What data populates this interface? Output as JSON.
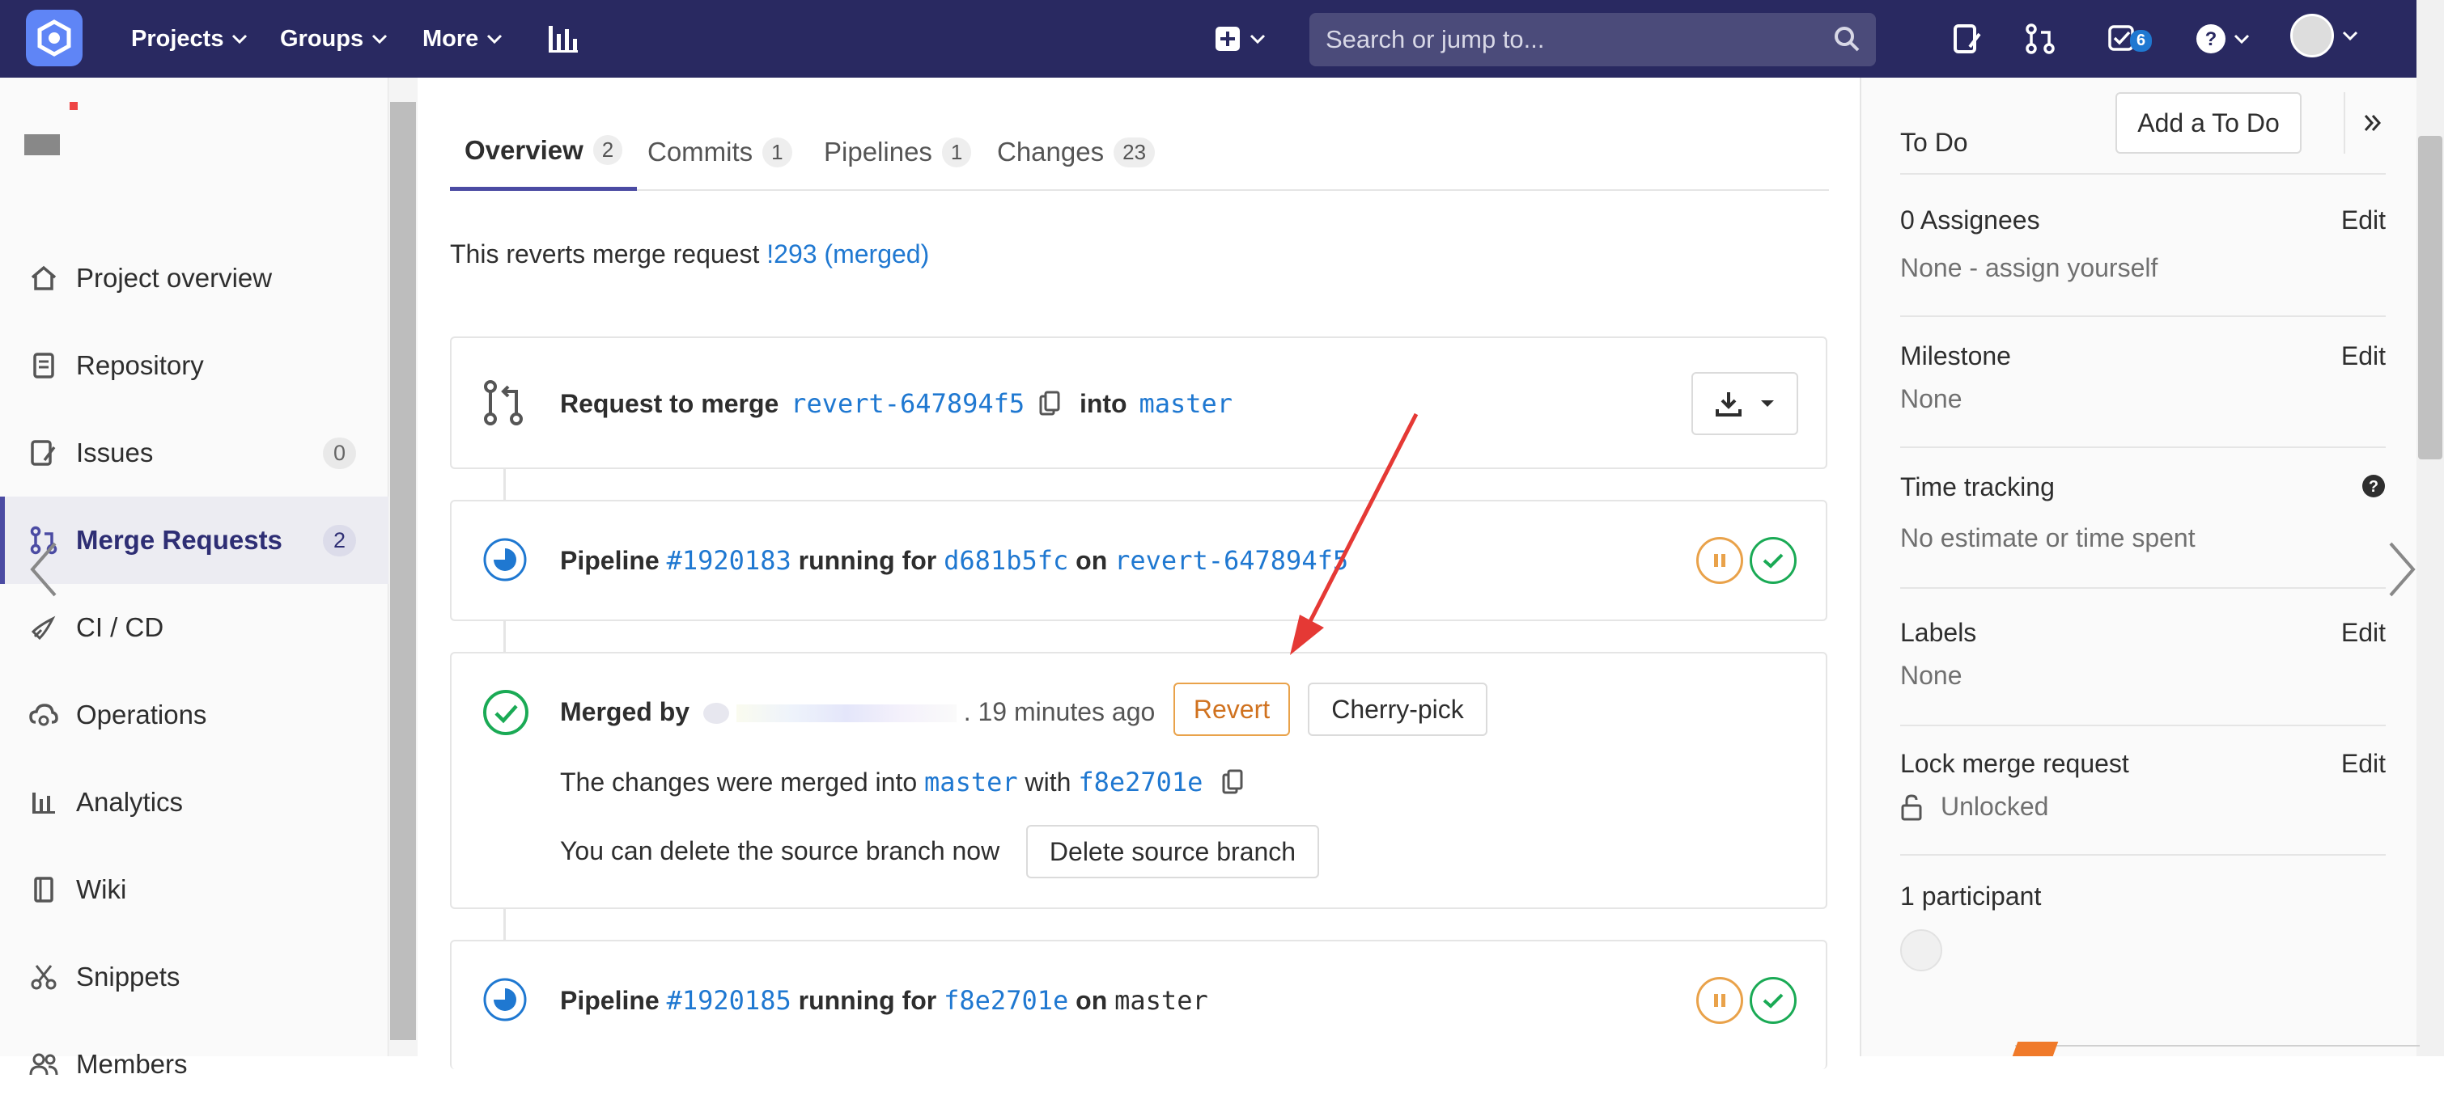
{
  "navbar": {
    "projects": "Projects",
    "groups": "Groups",
    "more": "More",
    "search_placeholder": "Search or jump to...",
    "todo_count": "6",
    "colors": {
      "bg": "#292961",
      "accent": "#1f78d1"
    }
  },
  "sidebar": {
    "items": [
      {
        "label": "Project overview",
        "icon": "home-icon"
      },
      {
        "label": "Repository",
        "icon": "repository-icon"
      },
      {
        "label": "Issues",
        "icon": "issues-icon",
        "count": "0"
      },
      {
        "label": "Merge Requests",
        "icon": "merge-request-icon",
        "count": "2",
        "active": true
      },
      {
        "label": "CI / CD",
        "icon": "rocket-icon"
      },
      {
        "label": "Operations",
        "icon": "cloud-gear-icon"
      },
      {
        "label": "Analytics",
        "icon": "chart-icon"
      },
      {
        "label": "Wiki",
        "icon": "book-icon"
      },
      {
        "label": "Snippets",
        "icon": "scissors-icon"
      },
      {
        "label": "Members",
        "icon": "users-icon"
      }
    ]
  },
  "tabs": [
    {
      "label": "Overview",
      "count": "2"
    },
    {
      "label": "Commits",
      "count": "1"
    },
    {
      "label": "Pipelines",
      "count": "1"
    },
    {
      "label": "Changes",
      "count": "23"
    }
  ],
  "description": {
    "prefix": "This reverts merge request ",
    "link": "!293 (merged)"
  },
  "merge_header": {
    "request_label": "Request to merge",
    "source_branch": "revert-647894f5",
    "into_label": "into",
    "target_branch": "master"
  },
  "pipeline1": {
    "prefix": "Pipeline",
    "id": "#1920183",
    "running_for": "running for",
    "commit": "d681b5fc",
    "on_label": "on",
    "branch": "revert-647894f5"
  },
  "merged": {
    "merged_by": "Merged by",
    "time": ". 19 minutes ago",
    "revert_label": "Revert",
    "cherry_pick_label": "Cherry-pick",
    "changes_prefix": "The changes were merged into",
    "target": "master",
    "with_label": "with",
    "commit": "f8e2701e",
    "delete_prompt": "You can delete the source branch now",
    "delete_button": "Delete source branch"
  },
  "pipeline2": {
    "prefix": "Pipeline",
    "id": "#1920185",
    "running_for": "running for",
    "commit": "f8e2701e",
    "on_label": "on",
    "branch": "master"
  },
  "right_sidebar": {
    "todo_label": "To Do",
    "add_todo": "Add a To Do",
    "assignees_title": "0 Assignees",
    "assignees_value": "None - assign yourself",
    "milestone_title": "Milestone",
    "milestone_value": "None",
    "time_title": "Time tracking",
    "time_value": "No estimate or time spent",
    "labels_title": "Labels",
    "labels_value": "None",
    "lock_title": "Lock merge request",
    "lock_value": "Unlocked",
    "participants": "1 participant",
    "edit": "Edit"
  }
}
